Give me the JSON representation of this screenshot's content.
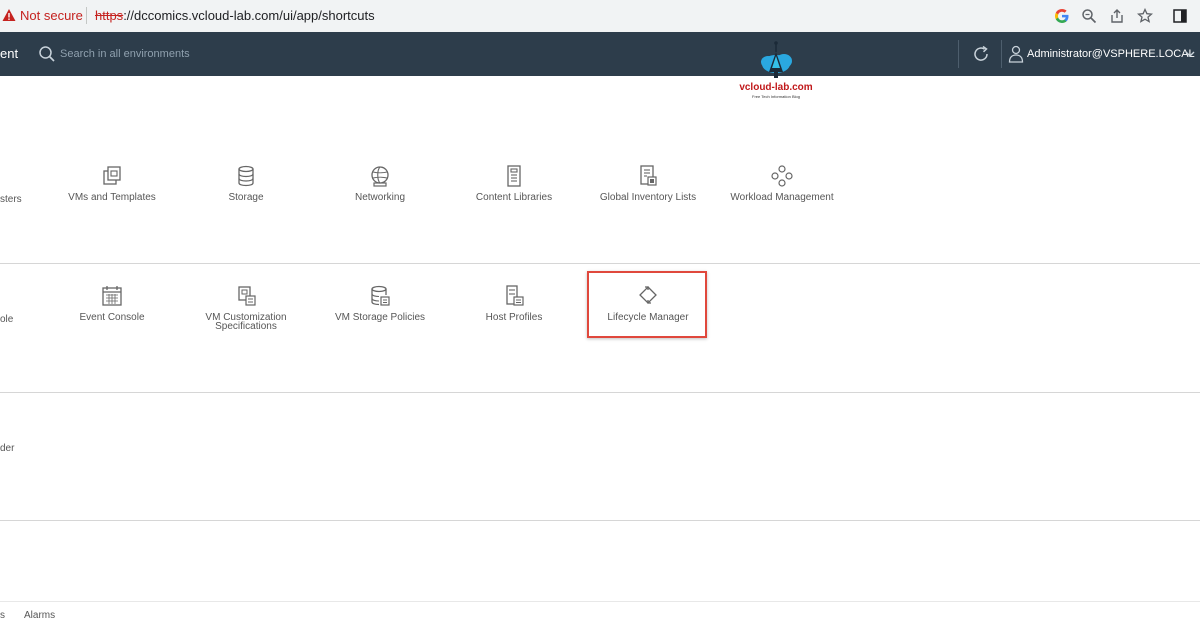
{
  "browser": {
    "security_label": "Not secure",
    "url_scheme": "https",
    "url_rest": "://dccomics.vcloud-lab.com/ui/app/shortcuts",
    "icons": [
      "google-icon",
      "zoom-icon",
      "share-icon",
      "star-icon",
      "sidepanel-icon"
    ]
  },
  "header": {
    "app_title": "ent",
    "search_placeholder": "Search in all environments",
    "user": "Administrator@VSPHERE.LOCAL"
  },
  "watermark": {
    "title": "vcloud-lab.com",
    "subtitle": "Free Tech Information Blog"
  },
  "inventories": {
    "clipped_label": "sters",
    "tiles": [
      {
        "label": "VMs and Templates",
        "icon": "vms-templates-icon"
      },
      {
        "label": "Storage",
        "icon": "storage-icon"
      },
      {
        "label": "Networking",
        "icon": "networking-icon"
      },
      {
        "label": "Content Libraries",
        "icon": "content-libraries-icon"
      },
      {
        "label": "Global Inventory Lists",
        "icon": "global-inventory-icon"
      },
      {
        "label": "Workload Management",
        "icon": "workload-management-icon"
      }
    ]
  },
  "monitoring": {
    "clipped_label": "ole",
    "tiles": [
      {
        "label": "Event Console",
        "icon": "event-console-icon"
      },
      {
        "label_line1": "VM Customization",
        "label_line2": "Specifications",
        "icon": "vm-customization-icon"
      },
      {
        "label": "VM Storage Policies",
        "icon": "vm-storage-policies-icon"
      },
      {
        "label": "Host Profiles",
        "icon": "host-profiles-icon"
      },
      {
        "label": "Lifecycle Manager",
        "icon": "lifecycle-manager-icon"
      }
    ]
  },
  "administration": {
    "clipped_label": "der"
  },
  "bottom_bar": {
    "clipped_tab": "s",
    "tab": "Alarms"
  },
  "colors": {
    "header_bg": "#2d3d4b",
    "highlight": "#e0483c",
    "warning": "#c5221f"
  }
}
